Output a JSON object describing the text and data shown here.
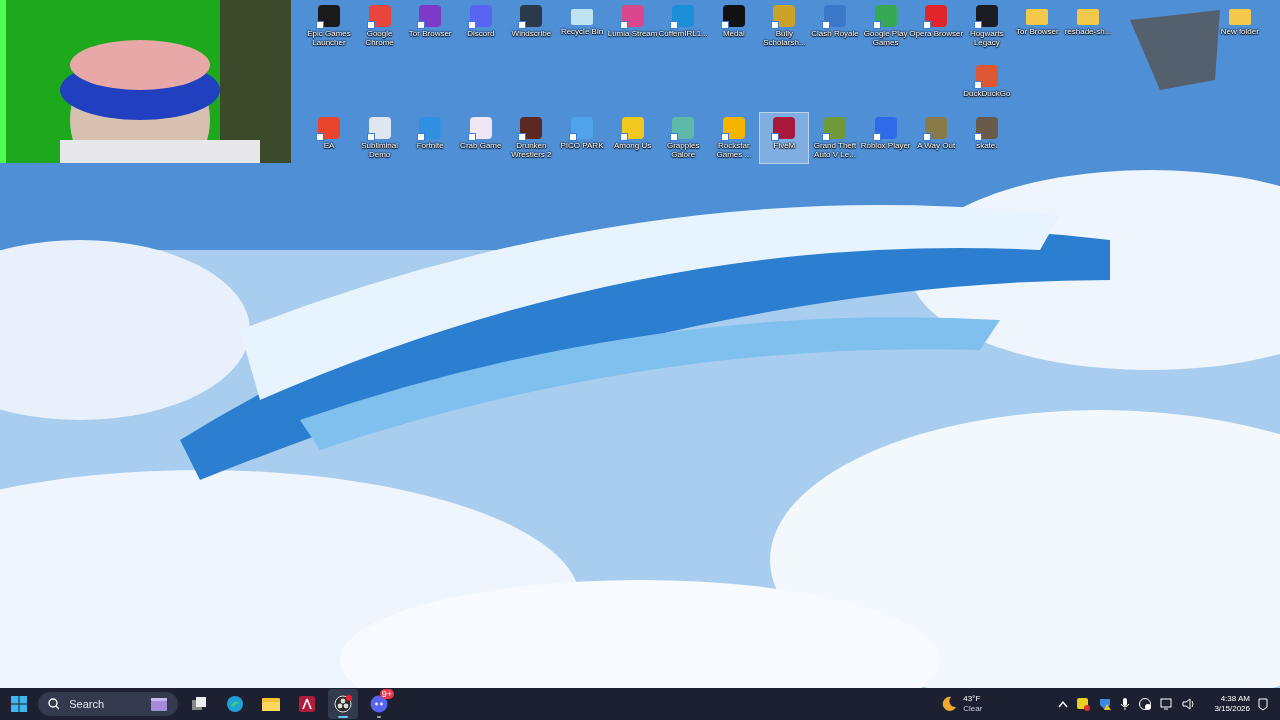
{
  "desktop": {
    "kind": "picture",
    "top_row": [
      {
        "label": "Epic Games Launcher",
        "color": "#1a1a1a",
        "shortcut": true,
        "selected": false
      },
      {
        "label": "Google Chrome",
        "color": "#e8453c",
        "shortcut": true,
        "selected": false
      },
      {
        "label": "Tor Browser",
        "color": "#7d3cc8",
        "shortcut": true,
        "selected": false
      },
      {
        "label": "Discord",
        "color": "#5865f2",
        "shortcut": true,
        "selected": false
      },
      {
        "label": "Windscribe",
        "color": "#2b3a4a",
        "shortcut": true,
        "selected": false
      },
      {
        "label": "Recycle Bin",
        "color": "#bfe3f2",
        "shortcut": false,
        "selected": false
      },
      {
        "label": "Lumia Stream",
        "color": "#d9478f",
        "shortcut": true,
        "selected": false
      },
      {
        "label": "CuffemIRL1...",
        "color": "#1c8fd8",
        "shortcut": true,
        "selected": false
      },
      {
        "label": "Medal",
        "color": "#111111",
        "shortcut": true,
        "selected": false
      },
      {
        "label": "Bully Scholarsh...",
        "color": "#c9a227",
        "shortcut": true,
        "selected": false
      },
      {
        "label": "Clash Royale",
        "color": "#3c78c8",
        "shortcut": true,
        "selected": false
      },
      {
        "label": "Google Play Games",
        "color": "#34a853",
        "shortcut": true,
        "selected": false
      },
      {
        "label": "Opera Browser",
        "color": "#e0262b",
        "shortcut": true,
        "selected": false
      },
      {
        "label": "Hogwarts Legacy",
        "color": "#1b1b22",
        "shortcut": true,
        "selected": false
      },
      {
        "label": "Tor Browser",
        "color": "#f4c84a",
        "shortcut": false,
        "selected": false
      },
      {
        "label": "reshade-sh...",
        "color": "#f4c84a",
        "shortcut": false,
        "selected": false
      }
    ],
    "top_right": [
      {
        "label": "New folder",
        "color": "#f4c84a",
        "shortcut": false,
        "selected": false
      }
    ],
    "middle_row": [
      {
        "label": "DuckDuckGo",
        "color": "#de5833",
        "shortcut": true,
        "selected": false
      }
    ],
    "bottom_row": [
      {
        "label": "EA",
        "color": "#e8452c",
        "shortcut": true,
        "selected": false
      },
      {
        "label": "Subliminal Demo",
        "color": "#dfe6ee",
        "shortcut": true,
        "selected": false
      },
      {
        "label": "Fortnite",
        "color": "#2f8fe0",
        "shortcut": true,
        "selected": false
      },
      {
        "label": "Crab Game",
        "color": "#efe8f4",
        "shortcut": true,
        "selected": false
      },
      {
        "label": "Drunken Wrestlers 2",
        "color": "#5a2a22",
        "shortcut": true,
        "selected": false
      },
      {
        "label": "PICO PARK",
        "color": "#4fa3e8",
        "shortcut": true,
        "selected": false
      },
      {
        "label": "Among Us",
        "color": "#f2c81e",
        "shortcut": true,
        "selected": false
      },
      {
        "label": "Grapples Galore",
        "color": "#5fb8a8",
        "shortcut": true,
        "selected": false
      },
      {
        "label": "Rockstar Games ...",
        "color": "#f4b400",
        "shortcut": true,
        "selected": false
      },
      {
        "label": "FiveM",
        "color": "#a8183a",
        "shortcut": true,
        "selected": true
      },
      {
        "label": "Grand Theft Auto V Le...",
        "color": "#6f9a3a",
        "shortcut": true,
        "selected": false
      },
      {
        "label": "Roblox Player",
        "color": "#2f6ae8",
        "shortcut": true,
        "selected": false
      },
      {
        "label": "A Way Out",
        "color": "#8a7a4a",
        "shortcut": true,
        "selected": false
      },
      {
        "label": "skate.",
        "color": "#6a5a4a",
        "shortcut": true,
        "selected": false
      }
    ]
  },
  "taskbar": {
    "search": {
      "placeholder": "Search"
    },
    "apps": [
      {
        "kind": "taskview",
        "running": false,
        "selected": false
      },
      {
        "kind": "edge",
        "running": false,
        "selected": false
      },
      {
        "kind": "explorer",
        "running": false,
        "selected": false
      },
      {
        "kind": "red",
        "running": false,
        "selected": false
      },
      {
        "kind": "obs",
        "running": true,
        "selected": true
      },
      {
        "kind": "discord",
        "running": true,
        "selected": false,
        "badge": "9+"
      }
    ],
    "weather": {
      "temperature": "43°F",
      "condition": "Clear"
    },
    "clock": {
      "time": "4:38 AM",
      "date": "3/15/2026"
    }
  }
}
